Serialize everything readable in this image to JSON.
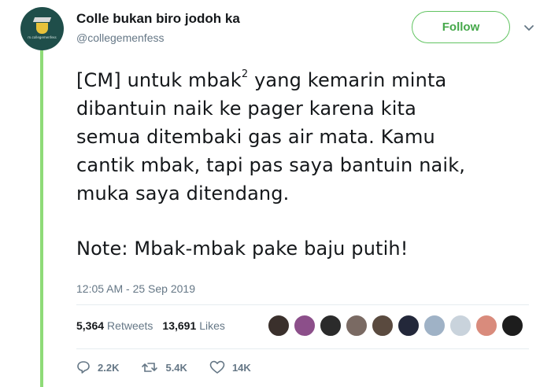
{
  "account": {
    "display_name": "Colle bukan biro jodoh ka",
    "handle": "@collegemenfess",
    "avatar_caption": "m.collegemenfess"
  },
  "follow_button": {
    "label": "Follow"
  },
  "tweet": {
    "lines": [
      "[CM] untuk mbak",
      "yang kemarin minta",
      "dibantuin naik ke pager karena kita",
      "semua ditembaki gas air mata. Kamu",
      "cantik mbak, tapi pas saya bantuin naik,",
      "muka saya ditendang.",
      "Note: Mbak-mbak pake baju putih!"
    ],
    "superscript": "2",
    "timestamp": "12:05 AM - 25 Sep 2019"
  },
  "stats": {
    "retweets_count": "5,364",
    "retweets_label": "Retweets",
    "likes_count": "13,691",
    "likes_label": "Likes"
  },
  "liker_avatars": [
    {
      "color": "#3a302c"
    },
    {
      "color": "#8c4f8a"
    },
    {
      "color": "#2b2b2b"
    },
    {
      "color": "#7a6a63"
    },
    {
      "color": "#5a4a3f"
    },
    {
      "color": "#23283a"
    },
    {
      "color": "#9fb2c6"
    },
    {
      "color": "#c9d3dc"
    },
    {
      "color": "#d98b7c"
    },
    {
      "color": "#1d1d1d"
    }
  ],
  "actions": {
    "replies": "2.2K",
    "retweets": "5.4K",
    "likes": "14K"
  },
  "colors": {
    "accent_bar": "#8edb78",
    "follow_border": "#62c462",
    "follow_text": "#45a84a",
    "secondary_text": "#657786"
  },
  "icons": {
    "caret": "chevron-down-icon",
    "reply": "reply-icon",
    "retweet": "retweet-icon",
    "like": "heart-icon"
  }
}
